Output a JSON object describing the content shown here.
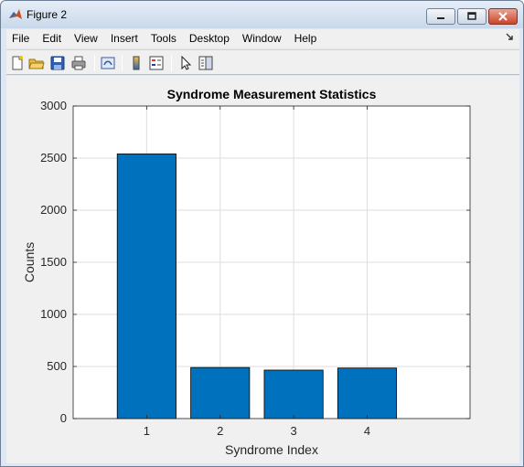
{
  "window": {
    "title": "Figure 2",
    "icon": "matlab-icon",
    "controls": {
      "minimize": "minimize-icon",
      "maximize": "maximize-icon",
      "close": "close-icon"
    }
  },
  "menu": {
    "items": [
      "File",
      "Edit",
      "View",
      "Insert",
      "Tools",
      "Desktop",
      "Window",
      "Help"
    ],
    "dock_icon": "dock-arrow-icon"
  },
  "toolbar": {
    "buttons": [
      "new-figure-icon",
      "open-file-icon",
      "save-icon",
      "print-icon",
      "link-plot-icon",
      "insert-colorbar-icon",
      "insert-legend-icon",
      "edit-plot-icon",
      "property-editor-icon"
    ]
  },
  "colors": {
    "bar": "#0072bd",
    "axes_bg": "#ffffff",
    "figure_bg": "#f0f0f0"
  },
  "chart_data": {
    "type": "bar",
    "title": "Syndrome Measurement Statistics",
    "xlabel": "Syndrome Index",
    "ylabel": "Counts",
    "categories": [
      "1",
      "2",
      "3",
      "4"
    ],
    "x": [
      1,
      2,
      3,
      4
    ],
    "values": [
      2540,
      490,
      465,
      485
    ],
    "xlim": [
      0,
      5.4
    ],
    "ylim": [
      0,
      3000
    ],
    "yticks": [
      "0",
      "500",
      "1000",
      "1500",
      "2000",
      "2500",
      "3000"
    ],
    "ytick_values": [
      0,
      500,
      1000,
      1500,
      2000,
      2500,
      3000
    ],
    "grid": true,
    "bar_color": "#0072bd"
  }
}
